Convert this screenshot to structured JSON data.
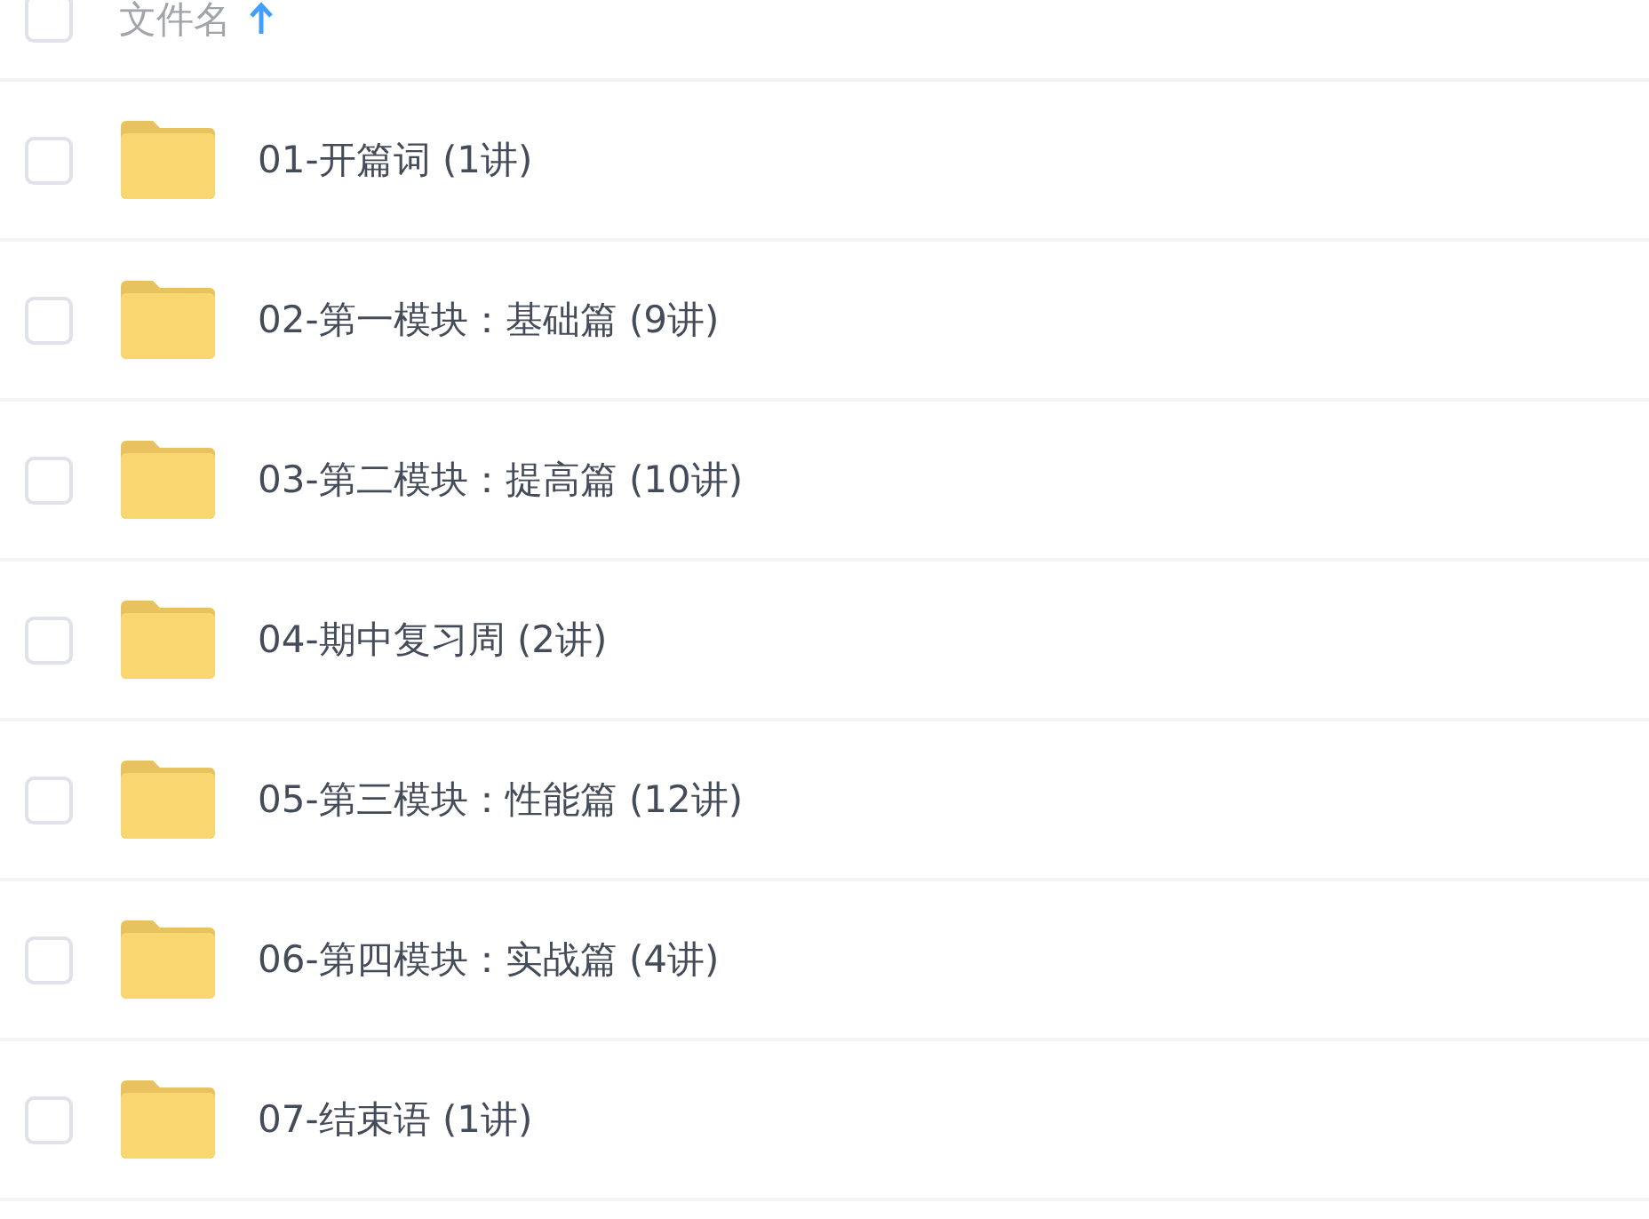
{
  "header": {
    "checked": false,
    "label": "文件名",
    "sort_ascending": true
  },
  "rows": [
    {
      "name": "01-开篇词 (1讲)",
      "checked": false
    },
    {
      "name": "02-第一模块：基础篇 (9讲)",
      "checked": false
    },
    {
      "name": "03-第二模块：提高篇 (10讲)",
      "checked": false
    },
    {
      "name": "04-期中复习周 (2讲)",
      "checked": false
    },
    {
      "name": "05-第三模块：性能篇 (12讲)",
      "checked": false
    },
    {
      "name": "06-第四模块：实战篇 (4讲)",
      "checked": false
    },
    {
      "name": "07-结束语 (1讲)",
      "checked": false
    }
  ]
}
